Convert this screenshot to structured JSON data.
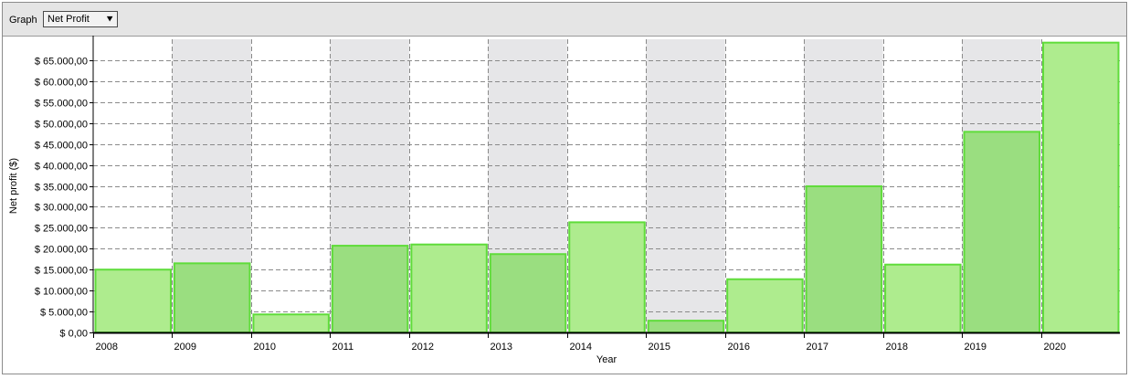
{
  "toolbar": {
    "label": "Graph",
    "select_value": "Net Profit",
    "select_arrow_icon": "chevron-down-icon"
  },
  "chart_data": {
    "type": "bar",
    "xlabel": "Year",
    "ylabel": "Net profit ($)",
    "categories": [
      "2008",
      "2009",
      "2010",
      "2011",
      "2012",
      "2013",
      "2014",
      "2015",
      "2016",
      "2017",
      "2018",
      "2019",
      "2020"
    ],
    "values": [
      15000,
      16500,
      4300,
      20700,
      21000,
      18700,
      26300,
      2800,
      12700,
      34900,
      16200,
      47900,
      69200
    ],
    "ylim": [
      0,
      70000
    ],
    "yticks": [
      0,
      5000,
      10000,
      15000,
      20000,
      25000,
      30000,
      35000,
      40000,
      45000,
      50000,
      55000,
      60000,
      65000
    ],
    "ytick_labels": [
      "$ 0,00",
      "$ 5.000,00",
      "$ 10.000,00",
      "$ 15.000,00",
      "$ 20.000,00",
      "$ 25.000,00",
      "$ 30.000,00",
      "$ 35.000,00",
      "$ 40.000,00",
      "$ 45.000,00",
      "$ 50.000,00",
      "$ 55.000,00",
      "$ 60.000,00",
      "$ 65.000,00"
    ],
    "grid": true,
    "colors": {
      "bar_fill_light": "#aeec8e",
      "bar_fill_dark": "#9ade80",
      "bar_stroke": "#5fdc3a",
      "alt_band": "#e6e6e8",
      "grid": "#8a8a8a"
    }
  }
}
